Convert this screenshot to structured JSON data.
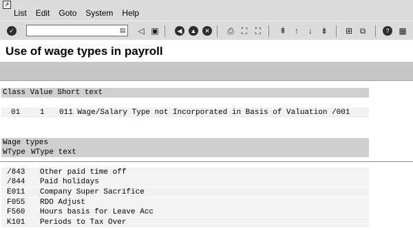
{
  "menubar": {
    "items": [
      "List",
      "Edit",
      "Goto",
      "System",
      "Help"
    ]
  },
  "toolbar": {
    "command_value": "",
    "icons": [
      "enter-icon",
      "history-icon",
      "back-icon",
      "save-icon",
      "back-green-icon",
      "exit-icon",
      "cancel-icon",
      "print-icon",
      "find-icon",
      "find-next-icon",
      "first-page-icon",
      "previous-page-icon",
      "next-page-icon",
      "last-page-icon",
      "create-session-icon",
      "shortcut-icon",
      "help-icon",
      "customize-layout-icon"
    ]
  },
  "page": {
    "title": "Use of wage types in payroll"
  },
  "class_section": {
    "header": "Class Value Short text",
    "row": {
      "class": "01",
      "value": "1",
      "short_text": "011 Wage/Salary Type not Incorporated in Basis of Valuation /001"
    }
  },
  "wage_types": {
    "title": "Wage types",
    "col_wtype": "WType",
    "col_text": "WType text",
    "rows": [
      {
        "code": "/843",
        "text": "Other paid time off"
      },
      {
        "code": "/844",
        "text": "Paid holidays"
      },
      {
        "code": "E011",
        "text": "Company Super Sacrifice"
      },
      {
        "code": "F055",
        "text": "RDO Adjust"
      },
      {
        "code": "F560",
        "text": "Hours basis for Leave Acc"
      },
      {
        "code": "K101",
        "text": "Periods to Tax Over"
      }
    ]
  }
}
